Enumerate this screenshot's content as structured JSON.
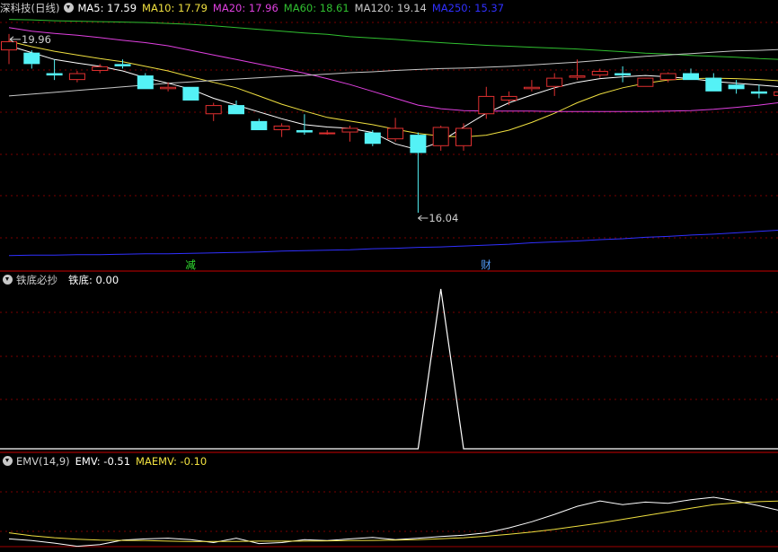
{
  "colors": {
    "up": "#e03030",
    "down": "#54f2f6",
    "ma5": "#ffffff",
    "ma10": "#f0e040",
    "ma20": "#e040e0",
    "ma60": "#30c030",
    "ma120": "#c8c8c8",
    "ma250": "#3030ff",
    "grid": "#7a0000",
    "panelBorder": "#a00000"
  },
  "main": {
    "title": "深科技(日线)",
    "legend": [
      {
        "label": "MA5: 17.59",
        "color": "#ffffff"
      },
      {
        "label": "MA10: 17.79",
        "color": "#f0e040"
      },
      {
        "label": "MA20: 17.96",
        "color": "#e040e0"
      },
      {
        "label": "MA60: 18.61",
        "color": "#30c030"
      },
      {
        "label": "MA120: 19.14",
        "color": "#c8c8c8"
      },
      {
        "label": "MA250: 15.37",
        "color": "#3030ff"
      }
    ],
    "high_label": "19.96",
    "low_label": "16.04",
    "markers": [
      {
        "text": "减",
        "index": 8,
        "color": "#30e030"
      },
      {
        "text": "财",
        "index": 21,
        "color": "#54a0ff"
      }
    ]
  },
  "sub1": {
    "title": "铁底必抄",
    "legend": [
      {
        "label": "铁底: 0.00",
        "color": "#ffffff"
      }
    ]
  },
  "sub2": {
    "title": "EMV(14,9)",
    "legend": [
      {
        "label": "EMV: -0.51",
        "color": "#ffffff"
      },
      {
        "label": "MAEMV: -0.10",
        "color": "#f0e040"
      }
    ]
  },
  "chart_data": [
    {
      "type": "candlestick",
      "title": "深科技(日线)",
      "ylim": [
        14.8,
        20.35
      ],
      "candles": [
        {
          "o": 19.6,
          "h": 19.96,
          "l": 19.3,
          "c": 19.8
        },
        {
          "o": 19.55,
          "h": 19.6,
          "l": 19.2,
          "c": 19.3
        },
        {
          "o": 19.1,
          "h": 19.4,
          "l": 18.95,
          "c": 19.05
        },
        {
          "o": 18.95,
          "h": 19.15,
          "l": 18.9,
          "c": 19.1
        },
        {
          "o": 19.15,
          "h": 19.3,
          "l": 19.1,
          "c": 19.25
        },
        {
          "o": 19.3,
          "h": 19.4,
          "l": 19.2,
          "c": 19.25
        },
        {
          "o": 19.05,
          "h": 19.1,
          "l": 18.75,
          "c": 18.75
        },
        {
          "o": 18.75,
          "h": 18.9,
          "l": 18.7,
          "c": 18.8
        },
        {
          "o": 18.8,
          "h": 18.8,
          "l": 18.5,
          "c": 18.5
        },
        {
          "o": 18.2,
          "h": 18.45,
          "l": 18.05,
          "c": 18.4
        },
        {
          "o": 18.4,
          "h": 18.5,
          "l": 18.2,
          "c": 18.2
        },
        {
          "o": 18.05,
          "h": 18.1,
          "l": 17.85,
          "c": 17.85
        },
        {
          "o": 17.85,
          "h": 18.0,
          "l": 17.7,
          "c": 17.95
        },
        {
          "o": 17.85,
          "h": 18.2,
          "l": 17.75,
          "c": 17.8
        },
        {
          "o": 17.8,
          "h": 17.85,
          "l": 17.75,
          "c": 17.8
        },
        {
          "o": 17.8,
          "h": 17.95,
          "l": 17.6,
          "c": 17.9
        },
        {
          "o": 17.8,
          "h": 17.85,
          "l": 17.5,
          "c": 17.55
        },
        {
          "o": 17.65,
          "h": 18.12,
          "l": 17.6,
          "c": 17.9
        },
        {
          "o": 17.75,
          "h": 17.8,
          "l": 16.04,
          "c": 17.35
        },
        {
          "o": 17.5,
          "h": 17.95,
          "l": 17.4,
          "c": 17.92
        },
        {
          "o": 17.5,
          "h": 18.0,
          "l": 17.4,
          "c": 17.9
        },
        {
          "o": 18.2,
          "h": 18.8,
          "l": 18.1,
          "c": 18.6
        },
        {
          "o": 18.5,
          "h": 18.7,
          "l": 18.4,
          "c": 18.6
        },
        {
          "o": 18.75,
          "h": 18.95,
          "l": 18.7,
          "c": 18.8
        },
        {
          "o": 18.8,
          "h": 19.1,
          "l": 18.6,
          "c": 19.0
        },
        {
          "o": 19.0,
          "h": 19.4,
          "l": 18.95,
          "c": 19.05
        },
        {
          "o": 19.05,
          "h": 19.2,
          "l": 19.0,
          "c": 19.15
        },
        {
          "o": 19.1,
          "h": 19.25,
          "l": 18.9,
          "c": 19.05
        },
        {
          "o": 18.8,
          "h": 19.0,
          "l": 18.8,
          "c": 19.0
        },
        {
          "o": 18.95,
          "h": 19.12,
          "l": 18.9,
          "c": 19.1
        },
        {
          "o": 19.1,
          "h": 19.2,
          "l": 18.95,
          "c": 18.95
        },
        {
          "o": 19.0,
          "h": 19.1,
          "l": 18.7,
          "c": 18.7
        },
        {
          "o": 18.85,
          "h": 18.95,
          "l": 18.65,
          "c": 18.75
        },
        {
          "o": 18.7,
          "h": 18.85,
          "l": 18.55,
          "c": 18.65
        },
        {
          "o": 18.6,
          "h": 18.75,
          "l": 18.5,
          "c": 18.7
        }
      ],
      "series": [
        {
          "name": "MA5",
          "values": [
            19.7,
            19.55,
            19.4,
            19.32,
            19.25,
            19.15,
            19.0,
            18.88,
            18.75,
            18.55,
            18.4,
            18.25,
            18.1,
            17.97,
            17.92,
            17.89,
            17.8,
            17.55,
            17.42,
            17.6,
            17.92,
            18.22,
            18.45,
            18.62,
            18.78,
            18.9,
            18.98,
            19.02,
            19.05,
            19.02,
            18.98,
            18.92,
            18.88,
            18.84,
            18.8
          ]
        },
        {
          "name": "MA10",
          "values": [
            19.8,
            19.68,
            19.58,
            19.5,
            19.42,
            19.35,
            19.25,
            19.15,
            19.02,
            18.9,
            18.78,
            18.6,
            18.42,
            18.27,
            18.13,
            18.05,
            17.97,
            17.87,
            17.78,
            17.72,
            17.7,
            17.74,
            17.85,
            18.02,
            18.22,
            18.45,
            18.64,
            18.78,
            18.88,
            18.95,
            18.98,
            18.99,
            18.98,
            18.96,
            18.93
          ]
        },
        {
          "name": "MA20",
          "values": [
            20.1,
            20.02,
            19.97,
            19.93,
            19.88,
            19.82,
            19.77,
            19.7,
            19.6,
            19.5,
            19.4,
            19.3,
            19.2,
            19.1,
            18.98,
            18.85,
            18.7,
            18.55,
            18.4,
            18.32,
            18.28,
            18.27,
            18.27,
            18.27,
            18.26,
            18.26,
            18.26,
            18.26,
            18.26,
            18.27,
            18.28,
            18.31,
            18.35,
            18.4,
            18.46
          ]
        },
        {
          "name": "MA60",
          "values": [
            20.28,
            20.27,
            20.25,
            20.24,
            20.23,
            20.22,
            20.21,
            20.19,
            20.17,
            20.14,
            20.1,
            20.06,
            20.02,
            19.98,
            19.95,
            19.9,
            19.87,
            19.84,
            19.8,
            19.77,
            19.74,
            19.71,
            19.69,
            19.67,
            19.65,
            19.63,
            19.6,
            19.57,
            19.54,
            19.52,
            19.49,
            19.47,
            19.45,
            19.42,
            19.4
          ]
        },
        {
          "name": "MA120",
          "values": [
            18.6,
            18.64,
            18.68,
            18.72,
            18.76,
            18.8,
            18.84,
            18.88,
            18.91,
            18.94,
            18.97,
            19.0,
            19.03,
            19.05,
            19.08,
            19.11,
            19.13,
            19.16,
            19.18,
            19.2,
            19.21,
            19.23,
            19.25,
            19.28,
            19.31,
            19.34,
            19.38,
            19.43,
            19.47,
            19.5,
            19.53,
            19.56,
            19.59,
            19.6,
            19.62
          ]
        },
        {
          "name": "MA250",
          "values": [
            15.1,
            15.11,
            15.11,
            15.12,
            15.12,
            15.13,
            15.14,
            15.14,
            15.15,
            15.16,
            15.17,
            15.18,
            15.2,
            15.21,
            15.22,
            15.23,
            15.25,
            15.26,
            15.28,
            15.29,
            15.31,
            15.33,
            15.35,
            15.38,
            15.4,
            15.42,
            15.45,
            15.47,
            15.5,
            15.52,
            15.55,
            15.57,
            15.6,
            15.63,
            15.66
          ]
        }
      ]
    },
    {
      "type": "line",
      "title": "铁底必抄",
      "ylim": [
        0,
        1
      ],
      "series": [
        {
          "name": "铁底",
          "values": [
            0,
            0,
            0,
            0,
            0,
            0,
            0,
            0,
            0,
            0,
            0,
            0,
            0,
            0,
            0,
            0,
            0,
            0,
            0,
            1,
            0,
            0,
            0,
            0,
            0,
            0,
            0,
            0,
            0,
            0,
            0,
            0,
            0,
            0,
            0
          ]
        }
      ]
    },
    {
      "type": "line",
      "title": "EMV(14,9)",
      "ylim": [
        -2.0,
        1.0
      ],
      "series": [
        {
          "name": "EMV",
          "values": [
            -1.65,
            -1.72,
            -1.82,
            -1.95,
            -1.88,
            -1.7,
            -1.65,
            -1.62,
            -1.68,
            -1.8,
            -1.62,
            -1.84,
            -1.8,
            -1.68,
            -1.72,
            -1.65,
            -1.59,
            -1.68,
            -1.62,
            -1.55,
            -1.5,
            -1.4,
            -1.2,
            -0.95,
            -0.65,
            -0.32,
            -0.1,
            -0.25,
            -0.15,
            -0.2,
            -0.05,
            0.05,
            -0.1,
            -0.3,
            -0.51
          ]
        },
        {
          "name": "MAEMV",
          "values": [
            -1.4,
            -1.52,
            -1.6,
            -1.66,
            -1.7,
            -1.71,
            -1.72,
            -1.74,
            -1.76,
            -1.75,
            -1.75,
            -1.74,
            -1.74,
            -1.74,
            -1.73,
            -1.72,
            -1.71,
            -1.7,
            -1.68,
            -1.64,
            -1.6,
            -1.54,
            -1.46,
            -1.37,
            -1.26,
            -1.13,
            -1.0,
            -0.85,
            -0.7,
            -0.55,
            -0.4,
            -0.25,
            -0.18,
            -0.13,
            -0.1
          ]
        }
      ]
    }
  ]
}
